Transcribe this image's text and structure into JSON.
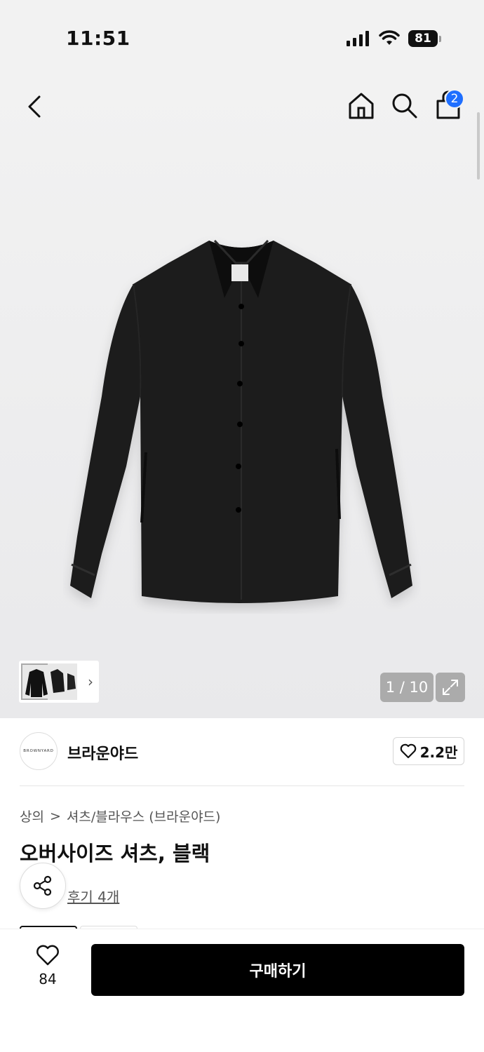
{
  "status_bar": {
    "time": "11:51",
    "battery": "81"
  },
  "header": {
    "cart_count": "2"
  },
  "gallery": {
    "counter": "1 / 10"
  },
  "brand": {
    "logo_text": "BROWNYARD",
    "name": "브라운야드",
    "likes": "2.2만"
  },
  "breadcrumb": {
    "category": "상의",
    "separator": ">",
    "subcategory": "셔츠/블라우스 (브라운야드)"
  },
  "product": {
    "title": "오버사이즈 셔츠, 블랙",
    "reviews": "후기 4개"
  },
  "bottom_bar": {
    "wish_count": "84",
    "buy_label": "구매하기"
  },
  "colors": {
    "accent_badge": "#1f6fff",
    "buy_button": "#000000"
  },
  "icons": [
    "back-icon",
    "home-icon",
    "search-icon",
    "cart-icon",
    "expand-icon",
    "heart-icon",
    "share-icon"
  ]
}
